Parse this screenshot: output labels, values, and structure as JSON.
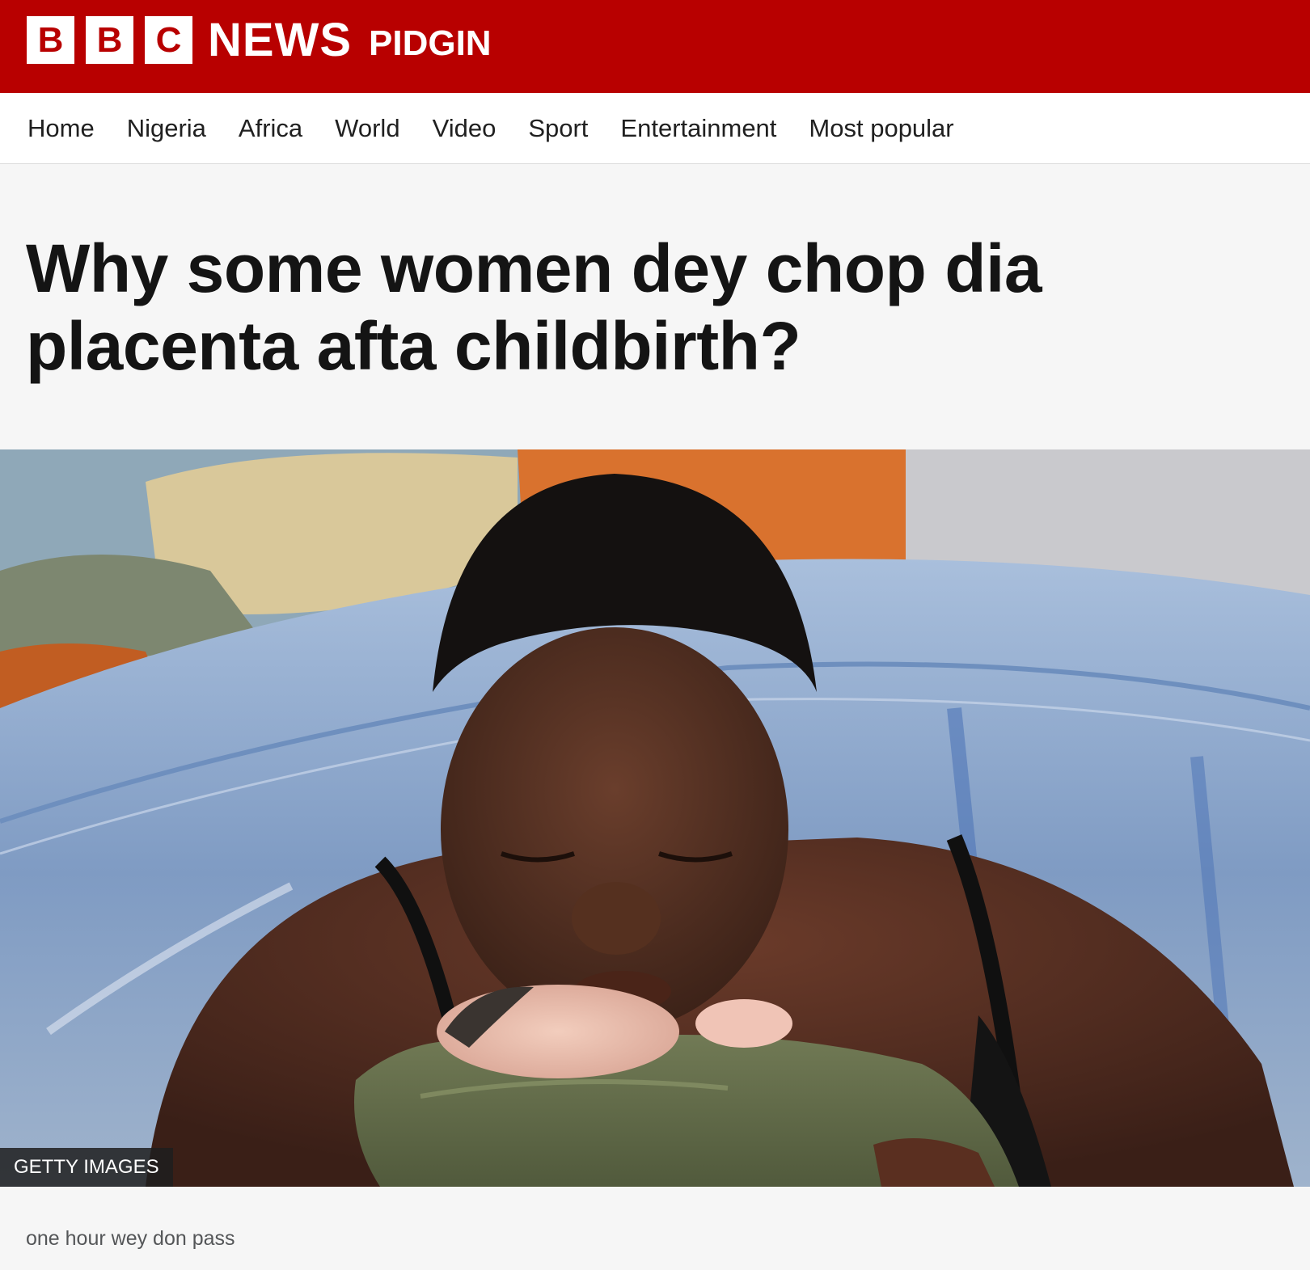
{
  "brand": {
    "blocks": [
      "B",
      "B",
      "C"
    ],
    "news": "NEWS",
    "service": "PIDGIN",
    "colors": {
      "brand_red": "#b80000",
      "logo_white": "#ffffff"
    }
  },
  "nav": {
    "items": [
      {
        "label": "Home"
      },
      {
        "label": "Nigeria"
      },
      {
        "label": "Africa"
      },
      {
        "label": "World"
      },
      {
        "label": "Video"
      },
      {
        "label": "Sport"
      },
      {
        "label": "Entertainment"
      },
      {
        "label": "Most popular"
      }
    ]
  },
  "article": {
    "headline": "Why some women dey chop dia placenta afta childbirth?",
    "image": {
      "credit": "GETTY IMAGES"
    },
    "timestamp": "one hour wey don pass"
  }
}
